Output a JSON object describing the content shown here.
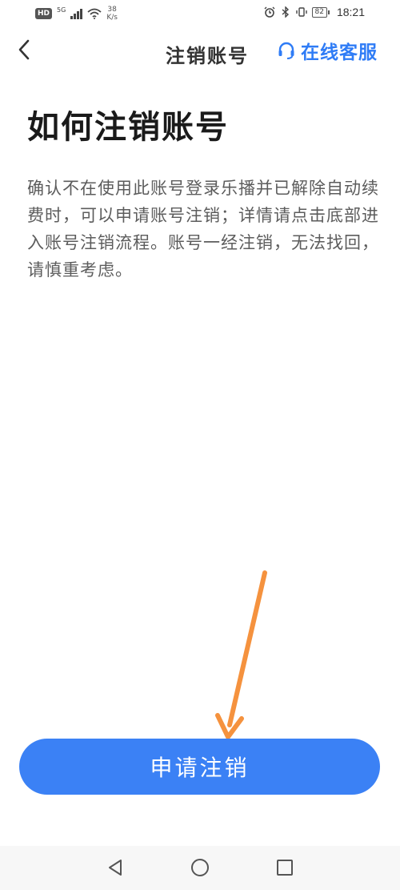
{
  "status_bar": {
    "hd": "HD",
    "network_gen": "5G",
    "net_speed_value": "38",
    "net_speed_unit": "K/s",
    "battery": "82",
    "time": "18:21",
    "icons": [
      "signal-icon",
      "wifi-icon",
      "alarm-icon",
      "bluetooth-icon",
      "vibrate-icon",
      "battery-icon"
    ]
  },
  "header": {
    "title": "注销账号",
    "customer_service_label": "在线客服",
    "back_icon": "chevron-left-icon",
    "cs_icon": "headset-icon"
  },
  "content": {
    "heading": "如何注销账号",
    "description": "确认不在使用此账号登录乐播并已解除自动续费时，可以申请账号注销；详情请点击底部进入账号注销流程。账号一经注销，无法找回，请慎重考虑。"
  },
  "action": {
    "apply_label": "申请注销"
  },
  "colors": {
    "primary": "#3b81f5",
    "link": "#2f7cf6",
    "annotation_arrow": "#f5923e"
  },
  "nav_bar": {
    "icons": [
      "back-triangle-icon",
      "home-circle-icon",
      "recents-square-icon"
    ]
  }
}
